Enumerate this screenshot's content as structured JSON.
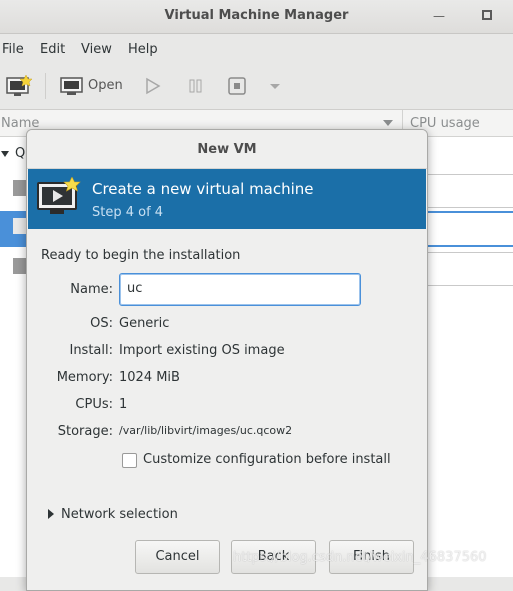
{
  "window": {
    "title": "Virtual Machine Manager"
  },
  "menu": [
    "File",
    "Edit",
    "View",
    "Help"
  ],
  "toolbar": {
    "open_label": "Open"
  },
  "list_header": {
    "name": "Name",
    "cpu": "CPU usage",
    "group_initial": "Q"
  },
  "dialog": {
    "title": "New VM",
    "banner_title": "Create a new virtual machine",
    "banner_step": "Step 4 of 4",
    "section": "Ready to begin the installation",
    "fields": {
      "name_label": "Name:",
      "name_value": "uc",
      "os_label": "OS:",
      "os_value": "Generic",
      "install_label": "Install:",
      "install_value": "Import existing OS image",
      "memory_label": "Memory:",
      "memory_value": "1024 MiB",
      "cpus_label": "CPUs:",
      "cpus_value": "1",
      "storage_label": "Storage:",
      "storage_value": "/var/lib/libvirt/images/uc.qcow2"
    },
    "customize_label": "Customize configuration before install",
    "customize_checked": false,
    "network_label": "Network selection",
    "buttons": {
      "cancel": "Cancel",
      "back": "Back",
      "finish": "Finish"
    }
  },
  "watermark": "https://blog.csdn.net/weixin_46837560",
  "colors": {
    "banner": "#1b6fa8",
    "selection": "#4a90d9"
  }
}
